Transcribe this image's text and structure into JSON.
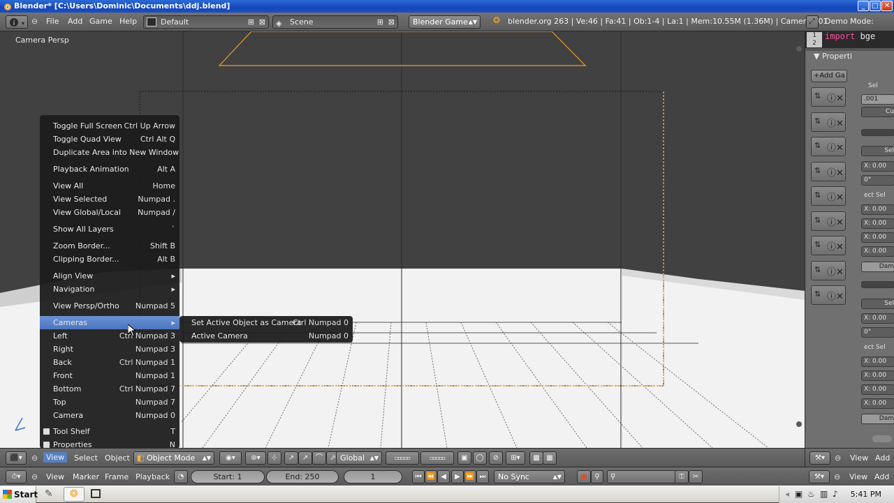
{
  "window": {
    "title": "Blender* [C:\\Users\\Dominic\\Documents\\ddj.blend]",
    "buttons": [
      "_",
      "□",
      "✕"
    ]
  },
  "info_header": {
    "menus": [
      "File",
      "Add",
      "Game",
      "Help"
    ],
    "screen_layout": "Default",
    "scene": "Scene",
    "engine": "Blender Game",
    "stats": "blender.org 263 | Ve:46 | Fa:41 | Ob:1-4 | La:1 | Mem:10.55M (1.36M) | Camera.001",
    "demo_mode": "Demo Mode:"
  },
  "viewport": {
    "label": "Camera Persp"
  },
  "text_editor": {
    "line_numbers": [
      "1",
      "2"
    ],
    "code_keyword": "import",
    "code_rest": " bge"
  },
  "properties_panel": {
    "title": "Properti",
    "add_button": "Add Ga",
    "sel_label": "Sel",
    "values": [
      ".001",
      "Cu",
      "Sel",
      "X: 0.00",
      "0°",
      "ect Sel",
      "X: 0.00",
      "X: 0.00",
      "X: 0.00",
      "X: 0.00",
      "Dam",
      "Sel",
      "X: 0.00",
      "0°",
      "ect Sel",
      "X: 0.00",
      "X: 0.00",
      "X: 0.00",
      "X: 0.00",
      "Dam"
    ]
  },
  "view_menu": {
    "items": [
      {
        "label": "Toggle Full Screen",
        "shortcut": "Ctrl Up Arrow"
      },
      {
        "label": "Toggle Quad View",
        "shortcut": "Ctrl Alt Q"
      },
      {
        "label": "Duplicate Area into New Window",
        "shortcut": ""
      },
      {
        "label": "Playback Animation",
        "shortcut": "Alt A"
      },
      {
        "label": "View All",
        "shortcut": "Home"
      },
      {
        "label": "View Selected",
        "shortcut": "Numpad ."
      },
      {
        "label": "View Global/Local",
        "shortcut": "Numpad /"
      },
      {
        "label": "Show All Layers",
        "shortcut": "`"
      },
      {
        "label": "Zoom Border...",
        "shortcut": "Shift B"
      },
      {
        "label": "Clipping Border...",
        "shortcut": "Alt B"
      },
      {
        "label": "Align View",
        "shortcut": "▸"
      },
      {
        "label": "Navigation",
        "shortcut": "▸"
      },
      {
        "label": "View Persp/Ortho",
        "shortcut": "Numpad 5"
      },
      {
        "label": "Cameras",
        "shortcut": "▸"
      },
      {
        "label": "Left",
        "shortcut": "Ctrl Numpad 3"
      },
      {
        "label": "Right",
        "shortcut": "Numpad 3"
      },
      {
        "label": "Back",
        "shortcut": "Ctrl Numpad 1"
      },
      {
        "label": "Front",
        "shortcut": "Numpad 1"
      },
      {
        "label": "Bottom",
        "shortcut": "Ctrl Numpad 7"
      },
      {
        "label": "Top",
        "shortcut": "Numpad 7"
      },
      {
        "label": "Camera",
        "shortcut": "Numpad 0"
      },
      {
        "label": "Tool Shelf",
        "shortcut": "T"
      },
      {
        "label": "Properties",
        "shortcut": "N"
      }
    ]
  },
  "cameras_submenu": {
    "items": [
      {
        "label": "Set Active Object as Camera",
        "shortcut": "Ctrl Numpad 0"
      },
      {
        "label": "Active Camera",
        "shortcut": "Numpad 0"
      }
    ]
  },
  "view3d_header": {
    "menus": [
      "View",
      "Select",
      "Object"
    ],
    "mode": "Object Mode",
    "orientation": "Global"
  },
  "timeline": {
    "menus": [
      "View",
      "Marker",
      "Frame",
      "Playback"
    ],
    "start": "Start: 1",
    "end": "End: 250",
    "current": "1",
    "sync": "No Sync"
  },
  "right_footer": {
    "menus": [
      "View",
      "Add"
    ]
  },
  "taskbar": {
    "start": "Start",
    "clock": "5:41 PM"
  },
  "colors": {
    "menu_highlight": "#5680c2",
    "camera_frame": "#e8a030",
    "title_blue": "#1a4fc0"
  }
}
